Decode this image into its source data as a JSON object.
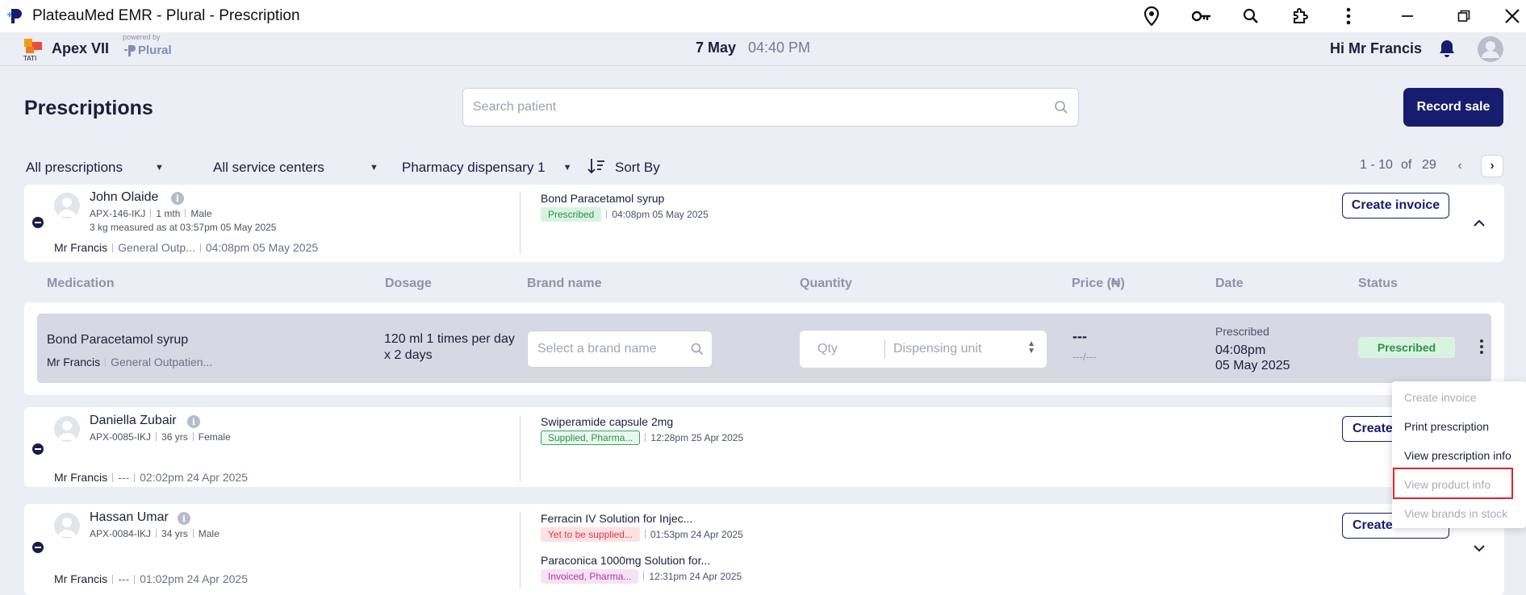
{
  "window": {
    "title": "PlateauMed EMR - Plural - Prescription"
  },
  "header": {
    "brand_name": "Apex VII",
    "powered_by": "powered by",
    "plural": "Plural",
    "logo_text": "TATI",
    "date": "7 May",
    "time": "04:40 PM",
    "greeting": "Hi Mr Francis"
  },
  "page": {
    "title": "Prescriptions",
    "search_placeholder": "Search patient",
    "record_sale": "Record sale"
  },
  "filters": {
    "prescriptions": "All prescriptions",
    "service_centers": "All service centers",
    "dispensary": "Pharmacy dispensary 1",
    "sort": "Sort By"
  },
  "pagination": {
    "range": "1 - 10",
    "of": "of",
    "total": "29",
    "prev": "‹",
    "next": "›"
  },
  "columns": {
    "medication": "Medication",
    "dosage": "Dosage",
    "brand": "Brand name",
    "quantity": "Quantity",
    "price": "Price (₦)",
    "date": "Date",
    "status": "Status"
  },
  "patients": [
    {
      "name": "John Olaide",
      "id": "APX-146-IKJ",
      "age": "1 mth",
      "sex": "Male",
      "weight": "3 kg measured as at 03:57pm 05 May 2025",
      "doctor": "Mr Francis",
      "dept": "General Outp...",
      "time": "04:08pm 05 May 2025",
      "drugs": [
        {
          "name": "Bond Paracetamol syrup",
          "status": "Prescribed",
          "time": "04:08pm 05 May 2025"
        }
      ],
      "action": "Create invoice"
    },
    {
      "name": "Daniella Zubair",
      "id": "APX-0085-IKJ",
      "age": "36 yrs",
      "sex": "Female",
      "doctor": "Mr Francis",
      "dept": "---",
      "time": "02:02pm 24 Apr 2025",
      "drugs": [
        {
          "name": "Swiperamide capsule 2mg",
          "status": "Supplied, Pharma...",
          "time": "12:28pm 25 Apr 2025"
        }
      ],
      "action": "Create"
    },
    {
      "name": "Hassan Umar",
      "id": "APX-0084-IKJ",
      "age": "34 yrs",
      "sex": "Male",
      "doctor": "Mr Francis",
      "dept": "---",
      "time": "01:02pm 24 Apr 2025",
      "drugs": [
        {
          "name": "Ferracin IV Solution for Injec...",
          "status": "Yet to be supplied...",
          "time": "01:53pm 24 Apr 2025"
        },
        {
          "name": "Paraconica 1000mg Solution for...",
          "status": "Invoiced, Pharma...",
          "time": "12:31pm 24 Apr 2025"
        }
      ],
      "action": "Create"
    }
  ],
  "expanded": {
    "medication": "Bond Paracetamol syrup",
    "doctor": "Mr Francis",
    "dept": "General Outpatien...",
    "dosage": "120 ml 1 times per day x 2 days",
    "brand_placeholder": "Select a brand name",
    "qty_placeholder": "Qty",
    "unit_placeholder": "Dispensing unit",
    "price": "---",
    "price_sub": "---/---",
    "date_label": "Prescribed",
    "date_time": "04:08pm",
    "date_day": "05 May 2025",
    "status": "Prescribed"
  },
  "menu": {
    "items": [
      "Create invoice",
      "Print prescription",
      "View prescription info",
      "View product info",
      "View brands in stock"
    ]
  },
  "colors": {
    "primary": "#171d6e",
    "background": "#eceef5",
    "success": "#2f8f4e",
    "danger": "#d73a49",
    "highlight": "#e0242f"
  }
}
